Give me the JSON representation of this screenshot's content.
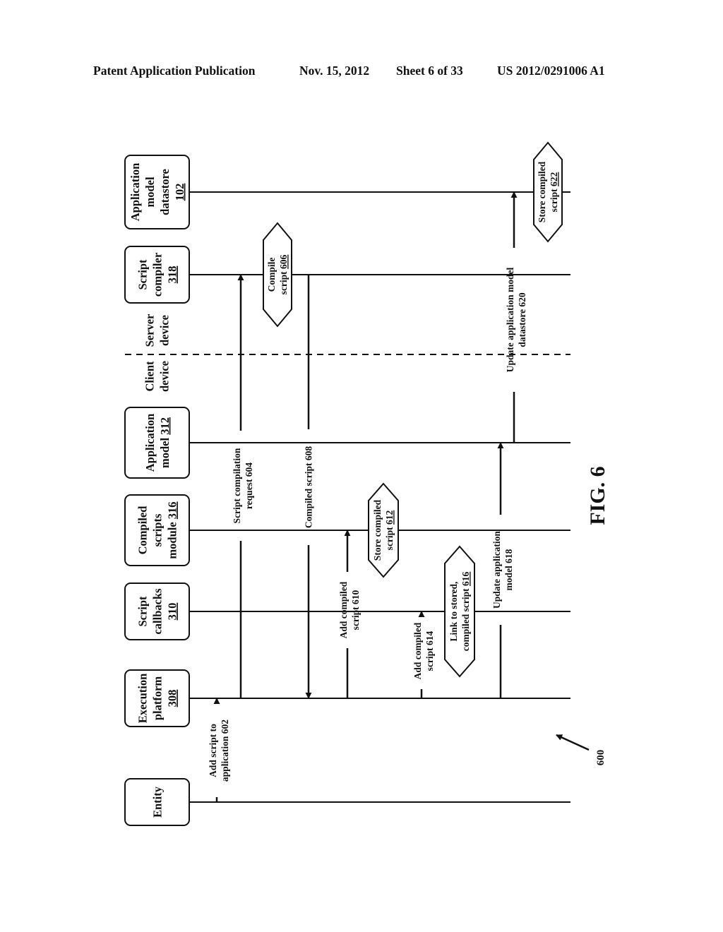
{
  "header": {
    "publication": "Patent Application Publication",
    "date": "Nov. 15, 2012",
    "sheet": "Sheet 6 of 33",
    "number": "US 2012/0291006 A1"
  },
  "figure": {
    "label": "FIG. 6",
    "reference": "600"
  },
  "zones": {
    "client": [
      "Client",
      "device"
    ],
    "server": [
      "Server",
      "device"
    ]
  },
  "participants": [
    {
      "id": "datastore",
      "lines": [
        "Application",
        "model",
        "datastore"
      ],
      "ref": "102",
      "ref_inline": false
    },
    {
      "id": "compiler",
      "lines": [
        "Script",
        "compiler"
      ],
      "ref": "318",
      "ref_inline": false
    },
    {
      "id": "appmodel",
      "lines": [
        "Application",
        "model"
      ],
      "ref": "312",
      "ref_inline": true
    },
    {
      "id": "compiled",
      "lines": [
        "Compiled",
        "scripts",
        "module"
      ],
      "ref": "316",
      "ref_inline": true
    },
    {
      "id": "callbacks",
      "lines": [
        "Script",
        "callbacks"
      ],
      "ref": "310",
      "ref_inline": false
    },
    {
      "id": "platform",
      "lines": [
        "Execution",
        "platform"
      ],
      "ref": "308",
      "ref_inline": false
    },
    {
      "id": "entity",
      "lines": [
        "Entity"
      ],
      "ref": "",
      "ref_inline": false
    }
  ],
  "messages": [
    {
      "id": "602",
      "from": "entity",
      "to": "platform",
      "lines": [
        "Add script to",
        "application 602"
      ]
    },
    {
      "id": "604",
      "from": "platform",
      "to": "compiler",
      "lines": [
        "Script compilation",
        "request 604"
      ]
    },
    {
      "id": "608",
      "from": "compiler",
      "to": "platform",
      "lines": [
        "Compiled script 608"
      ]
    },
    {
      "id": "610",
      "from": "platform",
      "to": "compiled",
      "lines": [
        "Add compiled",
        "script 610"
      ]
    },
    {
      "id": "614",
      "from": "platform",
      "to": "callbacks",
      "lines": [
        "Add compiled",
        "script 614"
      ]
    },
    {
      "id": "618",
      "from": "platform",
      "to": "appmodel",
      "lines": [
        "Update application",
        "model 618"
      ]
    },
    {
      "id": "620",
      "from": "appmodel",
      "to": "datastore",
      "lines": [
        "Update application model",
        "datastore 620"
      ]
    }
  ],
  "actions": [
    {
      "id": "606",
      "on": "compiler",
      "lines": [
        "Compile",
        "script"
      ],
      "ref": "606"
    },
    {
      "id": "612",
      "on": "compiled",
      "lines": [
        "Store compiled",
        "script"
      ],
      "ref": "612"
    },
    {
      "id": "616",
      "on": "callbacks",
      "lines": [
        "Link to stored,",
        "compiled script"
      ],
      "ref": "616"
    },
    {
      "id": "622",
      "on": "datastore",
      "lines": [
        "Store compiled",
        "script"
      ],
      "ref": "622"
    }
  ]
}
